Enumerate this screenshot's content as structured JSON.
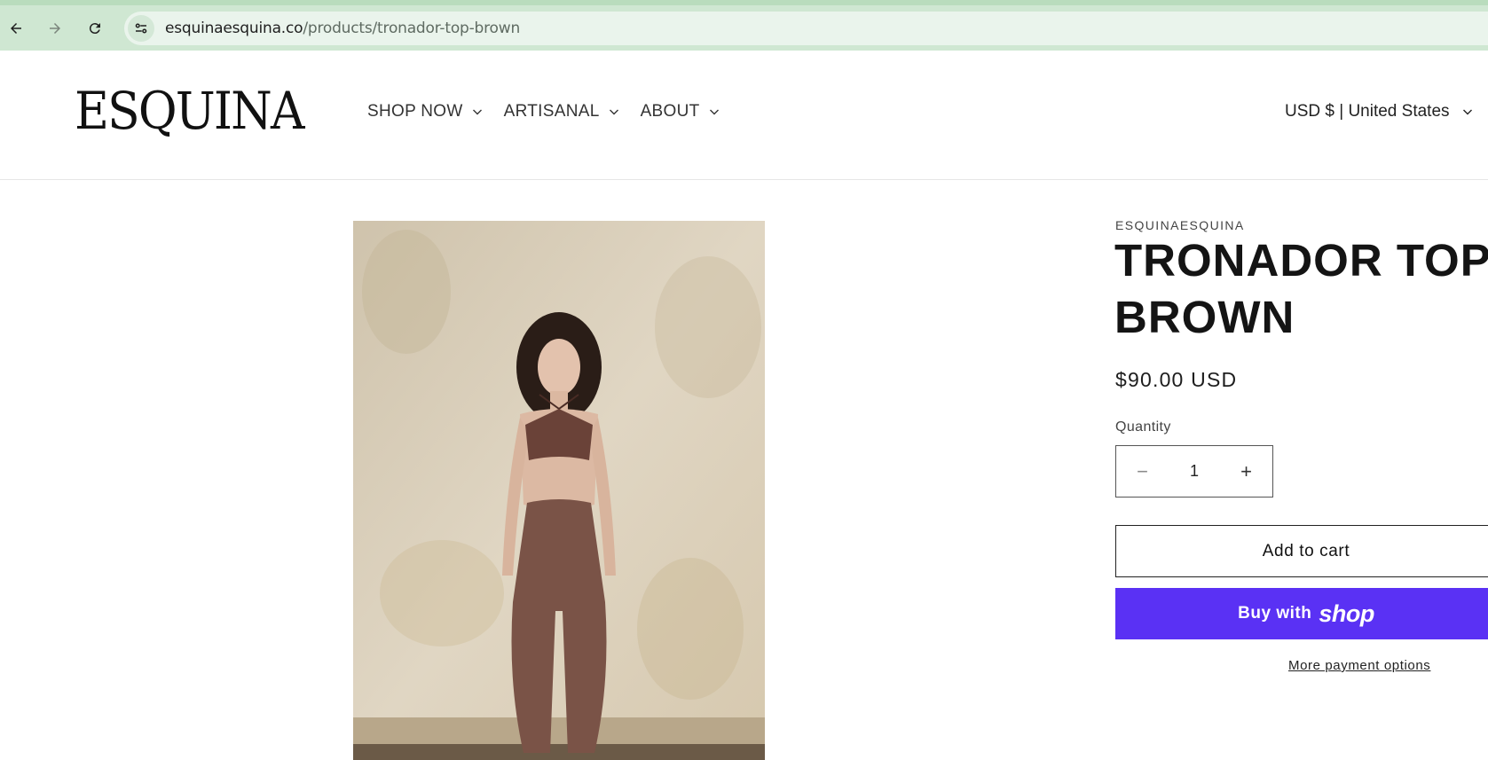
{
  "browser": {
    "url_host": "esquinaesquina.co",
    "url_path": "/products/tronador-top-brown"
  },
  "header": {
    "logo": "ESQUINA",
    "menu": [
      {
        "label": "SHOP NOW"
      },
      {
        "label": "ARTISANAL"
      },
      {
        "label": "ABOUT"
      }
    ],
    "currency": "USD $ | United States"
  },
  "product": {
    "vendor": "ESQUINAESQUINA",
    "title": "TRONADOR TOP BROWN",
    "price": "$90.00 USD",
    "quantity_label": "Quantity",
    "quantity_value": "1",
    "minus": "−",
    "plus": "+",
    "add_to_cart": "Add to cart",
    "buy_with": "Buy with",
    "shop_word": "shop",
    "more_payment": "More payment options"
  },
  "colors": {
    "shop_pay": "#5a31f4",
    "browser_bar": "#cfe7d2"
  }
}
